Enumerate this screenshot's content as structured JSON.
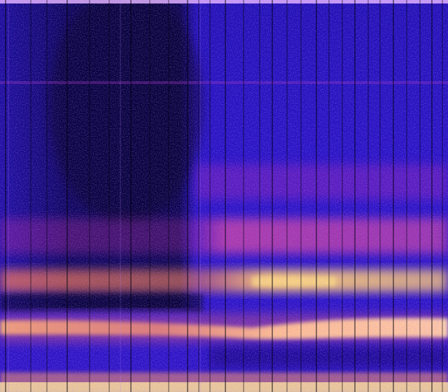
{
  "image": {
    "kind": "spectrogram",
    "colormap": [
      "#000000",
      "#1a0a8c",
      "#3a14c8",
      "#8a22c8",
      "#d23aa0",
      "#ff7a40",
      "#ffe07a",
      "#ffffc8"
    ],
    "background": "#10008a",
    "labels_visible": false
  }
}
